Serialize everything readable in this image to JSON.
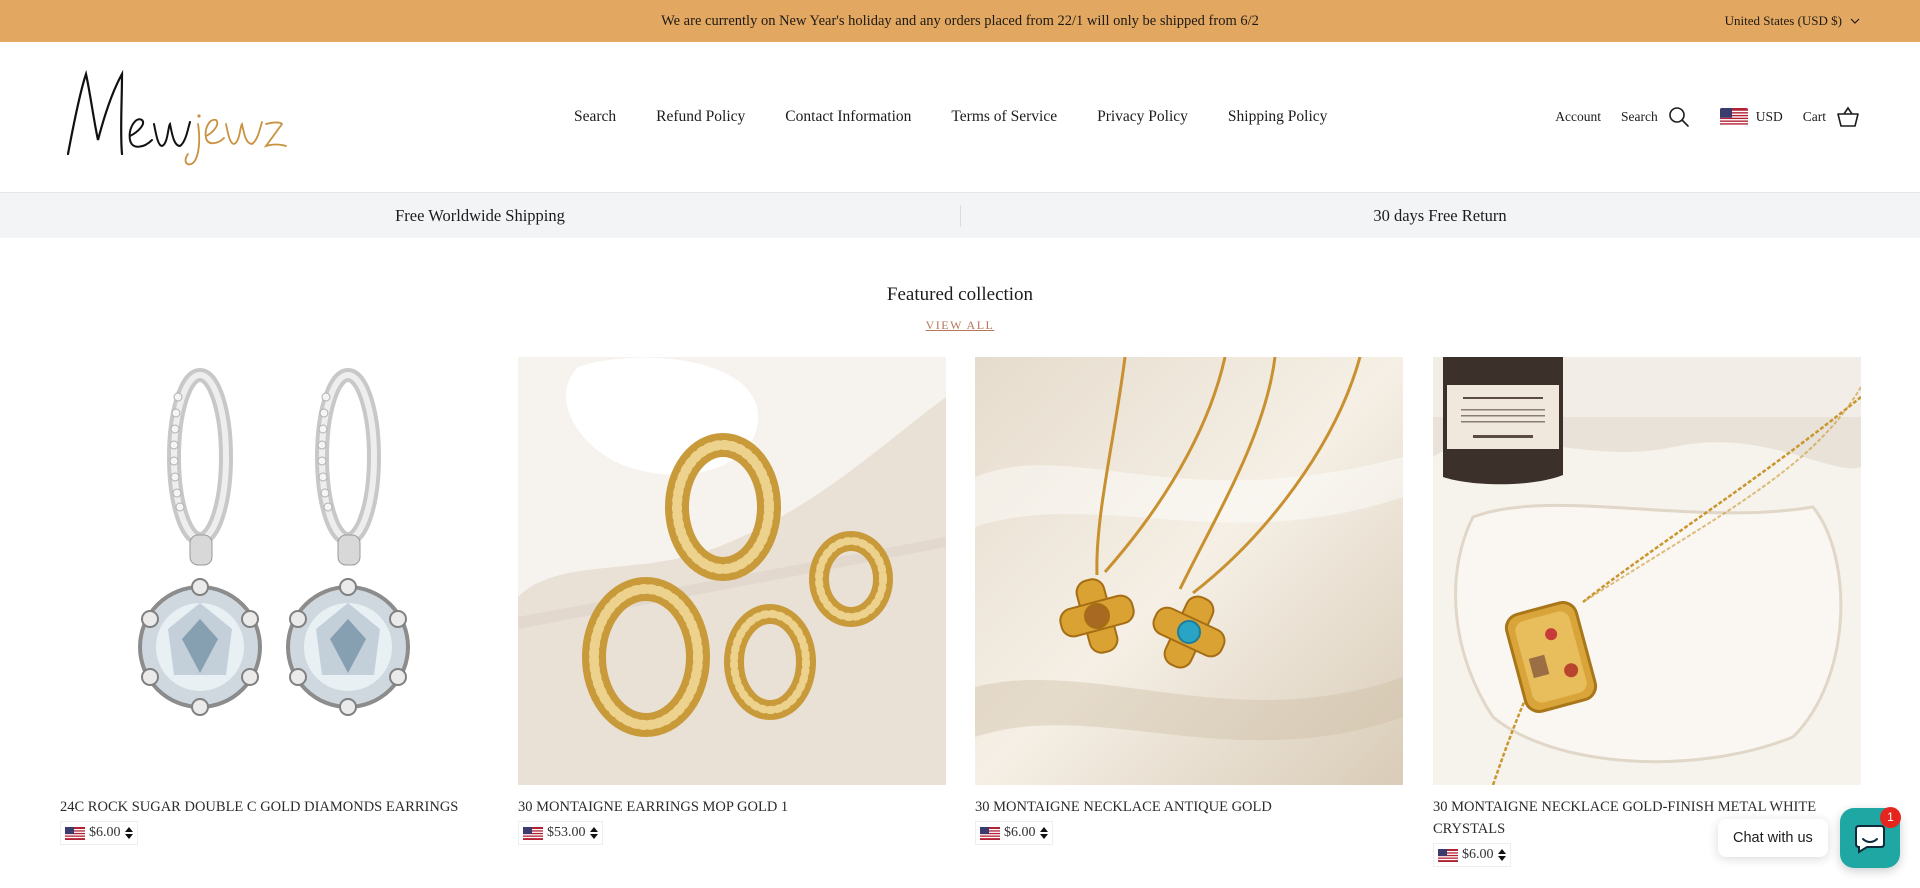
{
  "announcement": {
    "text": "We are currently on New Year's holiday and any orders placed from 22/1 will only be shipped from 6/2",
    "locale_label": "United States (USD $)",
    "bg_color": "#e2a862"
  },
  "header": {
    "logo_text": "Newjewz",
    "nav": [
      {
        "label": "Search"
      },
      {
        "label": "Refund Policy"
      },
      {
        "label": "Contact Information"
      },
      {
        "label": "Terms of Service"
      },
      {
        "label": "Privacy Policy"
      },
      {
        "label": "Shipping Policy"
      }
    ],
    "account_label": "Account",
    "search_label": "Search",
    "currency_label": "USD",
    "cart_label": "Cart"
  },
  "benefits": [
    {
      "label": "Free Worldwide Shipping"
    },
    {
      "label": "30 days Free Return"
    }
  ],
  "featured": {
    "title": "Featured collection",
    "view_all": "VIEW ALL",
    "accent_color": "#b4765c",
    "products": [
      {
        "title": "24C ROCK SUGAR DOUBLE C GOLD DIAMONDS EARRINGS",
        "price": "$6.00",
        "image": "silver-drop-earrings"
      },
      {
        "title": "30 MONTAIGNE EARRINGS MOP GOLD 1",
        "price": "$53.00",
        "image": "gold-hoop-earrings"
      },
      {
        "title": "30 MONTAIGNE NECKLACE ANTIQUE GOLD",
        "price": "$6.00",
        "image": "gold-cross-necklaces"
      },
      {
        "title": "30 MONTAIGNE NECKLACE GOLD-FINISH METAL WHITE CRYSTALS",
        "price": "$6.00",
        "image": "gold-pendant-necklace"
      }
    ]
  },
  "chat": {
    "label": "Chat with us",
    "badge": "1",
    "color": "#1fa7a3"
  }
}
